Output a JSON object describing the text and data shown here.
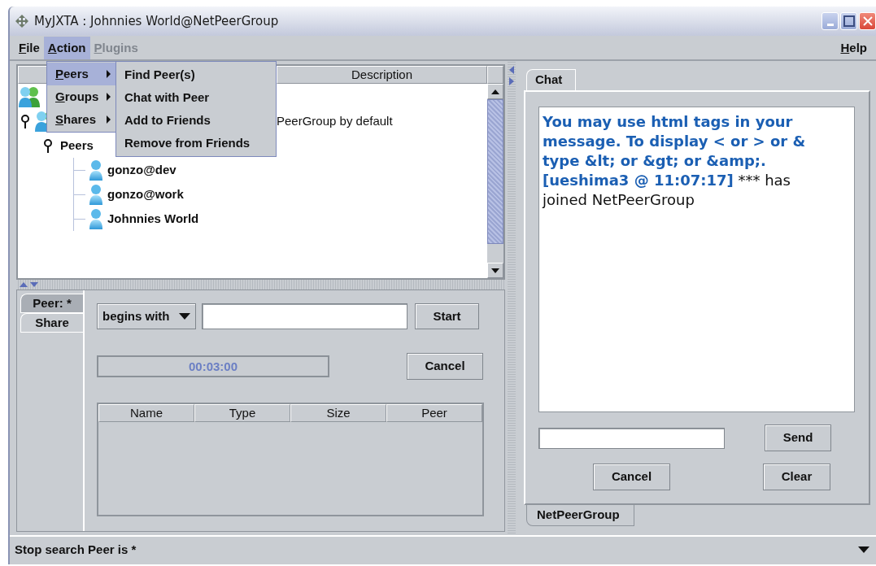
{
  "window": {
    "title": "MyJXTA : Johnnies World@NetPeerGroup"
  },
  "menu_bar": {
    "menus": [
      {
        "label": "File",
        "selected": false,
        "disabled": false
      },
      {
        "label": "Action",
        "selected": true,
        "disabled": false
      },
      {
        "label": "Plugins",
        "selected": false,
        "disabled": true
      }
    ],
    "help": {
      "label": "Help"
    }
  },
  "action_menu": {
    "items": [
      {
        "label": "Peers",
        "selected": true
      },
      {
        "label": "Groups",
        "selected": false
      },
      {
        "label": "Shares",
        "selected": false
      }
    ],
    "submenu": [
      "Find Peer(s)",
      "Chat with Peer",
      "Add to Friends",
      "Remove from Friends"
    ]
  },
  "tree_table": {
    "description_column": "Description",
    "rows": [
      {
        "kind": "group",
        "children": [
          {
            "kind": "group",
            "expanded": true,
            "description": "PeerGroup by default",
            "children": [
              {
                "label": "Peers",
                "expanded": true,
                "children": [
                  {
                    "kind": "peer",
                    "label": "gonzo@dev"
                  },
                  {
                    "kind": "peer",
                    "label": "gonzo@work"
                  },
                  {
                    "kind": "peer",
                    "label": "Johnnies World"
                  }
                ]
              }
            ]
          }
        ]
      }
    ]
  },
  "search_panel": {
    "tabs": [
      {
        "label": "Peer: *",
        "selected": true
      },
      {
        "label": "Share",
        "selected": false
      }
    ],
    "match_mode": "begins with",
    "start_button": "Start",
    "timer": "00:03:00",
    "cancel_button": "Cancel",
    "results_table": {
      "columns": [
        "Name",
        "Type",
        "Size",
        "Peer"
      ]
    }
  },
  "chat": {
    "tabs": [
      {
        "label": "Chat",
        "selected": true
      }
    ],
    "messages": [
      {
        "kind": "system",
        "text": "You may use html tags in your message. To display < or > or & type &lt; or &gt; or &amp;."
      },
      {
        "kind": "user",
        "sender": "[ueshima3 @ 11:07:17]",
        "text": "*** has joined NetPeerGroup"
      }
    ],
    "send_button": "Send",
    "cancel_button": "Cancel",
    "clear_button": "Clear",
    "group_tabs": [
      {
        "label": "NetPeerGroup",
        "selected": true
      }
    ]
  },
  "status_bar": {
    "text": "Stop search Peer is *"
  }
}
